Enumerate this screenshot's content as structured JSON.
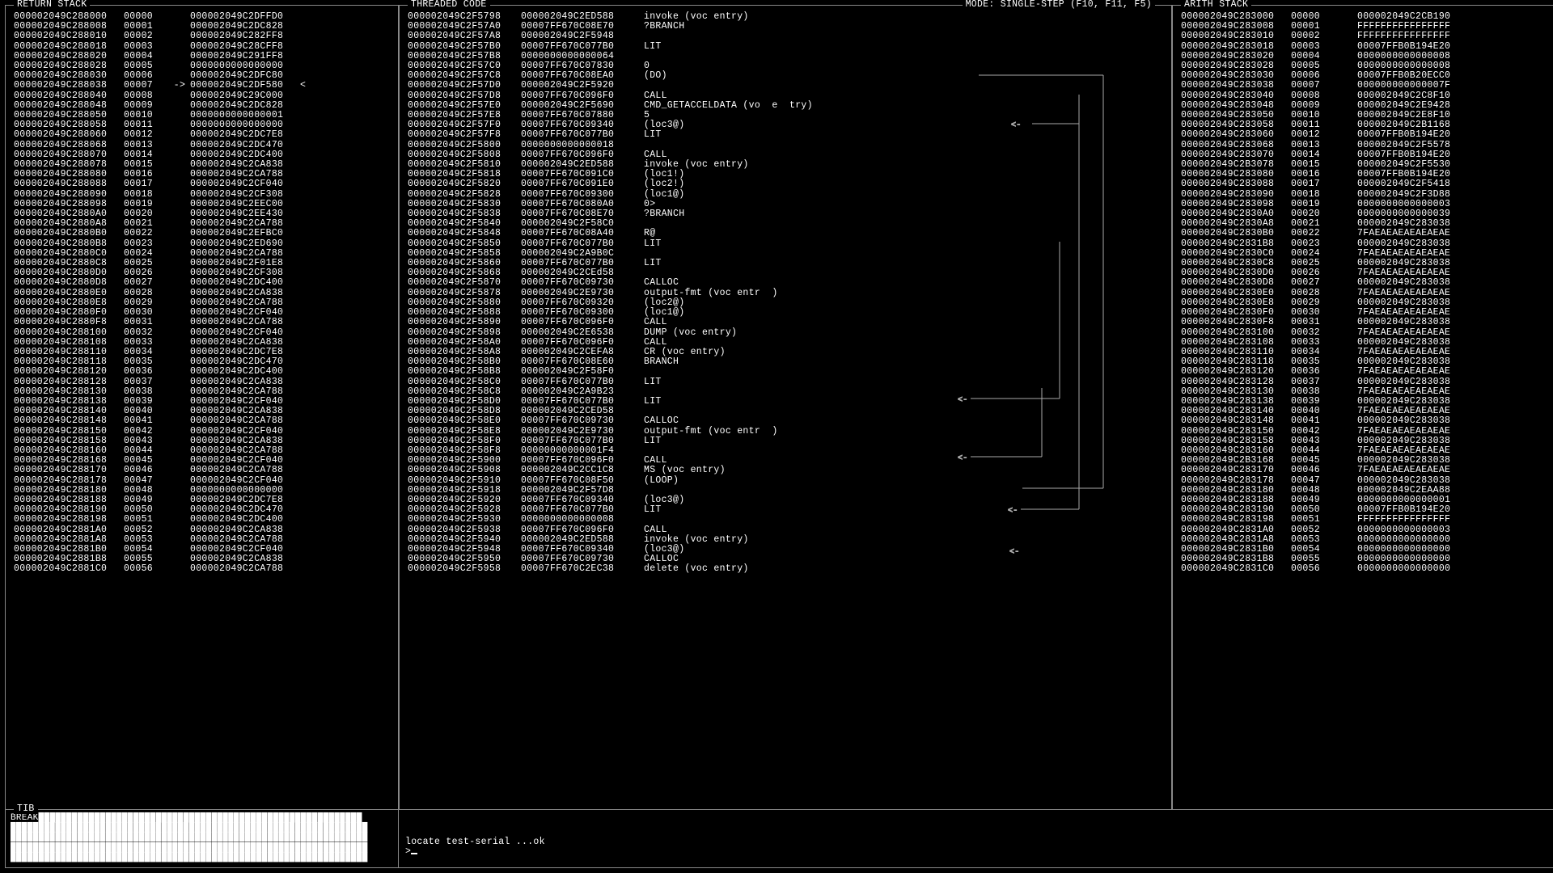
{
  "headers": {
    "return_stack": "RETURN STACK",
    "threaded_code": "THREADED CODE",
    "mode": "MODE: SINGLE-STEP (F10, F11, F5)",
    "arith_stack": "ARITH STACK",
    "tib": "TIB"
  },
  "return_stack": [
    {
      "addr": "000002049C288000",
      "idx": "00000",
      "hex": "000002049C2DFFD0"
    },
    {
      "addr": "000002049C288008",
      "idx": "00001",
      "hex": "000002049C2DC828"
    },
    {
      "addr": "000002049C288010",
      "idx": "00002",
      "hex": "000002049C282FF8"
    },
    {
      "addr": "000002049C288018",
      "idx": "00003",
      "hex": "000002049C28CFF8"
    },
    {
      "addr": "000002049C288020",
      "idx": "00004",
      "hex": "000002049C291FF8"
    },
    {
      "addr": "000002049C288028",
      "idx": "00005",
      "hex": "0000000000000000"
    },
    {
      "addr": "000002049C288030",
      "idx": "00006",
      "hex": "000002049C2DFC80"
    },
    {
      "addr": "000002049C288038",
      "idx": "00007",
      "hex": "000002049C2DF580",
      "arrow": "->",
      "end": "<"
    },
    {
      "addr": "000002049C288040",
      "idx": "00008",
      "hex": "000002049C29C000"
    },
    {
      "addr": "000002049C288048",
      "idx": "00009",
      "hex": "000002049C2DC828"
    },
    {
      "addr": "000002049C288050",
      "idx": "00010",
      "hex": "0000000000000001"
    },
    {
      "addr": "000002049C288058",
      "idx": "00011",
      "hex": "0000000000000000"
    },
    {
      "addr": "000002049C288060",
      "idx": "00012",
      "hex": "000002049C2DC7E8"
    },
    {
      "addr": "000002049C288068",
      "idx": "00013",
      "hex": "000002049C2DC470"
    },
    {
      "addr": "000002049C288070",
      "idx": "00014",
      "hex": "000002049C2DC400"
    },
    {
      "addr": "000002049C288078",
      "idx": "00015",
      "hex": "000002049C2CA838"
    },
    {
      "addr": "000002049C288080",
      "idx": "00016",
      "hex": "000002049C2CA788"
    },
    {
      "addr": "000002049C288088",
      "idx": "00017",
      "hex": "000002049C2CF040"
    },
    {
      "addr": "000002049C288090",
      "idx": "00018",
      "hex": "000002049C2CF308"
    },
    {
      "addr": "000002049C288098",
      "idx": "00019",
      "hex": "000002049C2EEC00"
    },
    {
      "addr": "000002049C2880A0",
      "idx": "00020",
      "hex": "000002049C2EE430"
    },
    {
      "addr": "000002049C2880A8",
      "idx": "00021",
      "hex": "000002049C2CA788"
    },
    {
      "addr": "000002049C2880B0",
      "idx": "00022",
      "hex": "000002049C2EFBC0"
    },
    {
      "addr": "000002049C2880B8",
      "idx": "00023",
      "hex": "000002049C2ED690"
    },
    {
      "addr": "000002049C2880C0",
      "idx": "00024",
      "hex": "000002049C2CA788"
    },
    {
      "addr": "000002049C2880C8",
      "idx": "00025",
      "hex": "000002049C2F01E8"
    },
    {
      "addr": "000002049C2880D0",
      "idx": "00026",
      "hex": "000002049C2CF308"
    },
    {
      "addr": "000002049C2880D8",
      "idx": "00027",
      "hex": "000002049C2DC400"
    },
    {
      "addr": "000002049C2880E0",
      "idx": "00028",
      "hex": "000002049C2CA838"
    },
    {
      "addr": "000002049C2880E8",
      "idx": "00029",
      "hex": "000002049C2CA788"
    },
    {
      "addr": "000002049C2880F0",
      "idx": "00030",
      "hex": "000002049C2CF040"
    },
    {
      "addr": "000002049C2880F8",
      "idx": "00031",
      "hex": "000002049C2CA788"
    },
    {
      "addr": "000002049C288100",
      "idx": "00032",
      "hex": "000002049C2CF040"
    },
    {
      "addr": "000002049C288108",
      "idx": "00033",
      "hex": "000002049C2CA838"
    },
    {
      "addr": "000002049C288110",
      "idx": "00034",
      "hex": "000002049C2DC7E8"
    },
    {
      "addr": "000002049C288118",
      "idx": "00035",
      "hex": "000002049C2DC470"
    },
    {
      "addr": "000002049C288120",
      "idx": "00036",
      "hex": "000002049C2DC400"
    },
    {
      "addr": "000002049C288128",
      "idx": "00037",
      "hex": "000002049C2CA838"
    },
    {
      "addr": "000002049C288130",
      "idx": "00038",
      "hex": "000002049C2CA788"
    },
    {
      "addr": "000002049C288138",
      "idx": "00039",
      "hex": "000002049C2CF040"
    },
    {
      "addr": "000002049C288140",
      "idx": "00040",
      "hex": "000002049C2CA838"
    },
    {
      "addr": "000002049C288148",
      "idx": "00041",
      "hex": "000002049C2CA788"
    },
    {
      "addr": "000002049C288150",
      "idx": "00042",
      "hex": "000002049C2CF040"
    },
    {
      "addr": "000002049C288158",
      "idx": "00043",
      "hex": "000002049C2CA838"
    },
    {
      "addr": "000002049C288160",
      "idx": "00044",
      "hex": "000002049C2CA788"
    },
    {
      "addr": "000002049C288168",
      "idx": "00045",
      "hex": "000002049C2CF040"
    },
    {
      "addr": "000002049C288170",
      "idx": "00046",
      "hex": "000002049C2CA788"
    },
    {
      "addr": "000002049C288178",
      "idx": "00047",
      "hex": "000002049C2CF040"
    },
    {
      "addr": "000002049C288180",
      "idx": "00048",
      "hex": "0000000000000000"
    },
    {
      "addr": "000002049C288188",
      "idx": "00049",
      "hex": "000002049C2DC7E8"
    },
    {
      "addr": "000002049C288190",
      "idx": "00050",
      "hex": "000002049C2DC470"
    },
    {
      "addr": "000002049C288198",
      "idx": "00051",
      "hex": "000002049C2DC400"
    },
    {
      "addr": "000002049C2881A0",
      "idx": "00052",
      "hex": "000002049C2CA838"
    },
    {
      "addr": "000002049C2881A8",
      "idx": "00053",
      "hex": "000002049C2CA788"
    },
    {
      "addr": "000002049C2881B0",
      "idx": "00054",
      "hex": "000002049C2CF040"
    },
    {
      "addr": "000002049C2881B8",
      "idx": "00055",
      "hex": "000002049C2CA838"
    },
    {
      "addr": "000002049C2881C0",
      "idx": "00056",
      "hex": "000002049C2CA788"
    }
  ],
  "threaded_code": [
    {
      "addr": "000002049C2F5798",
      "hex": "000002049C2ED588",
      "op": "invoke (voc entry)"
    },
    {
      "addr": "000002049C2F57A0",
      "hex": "00007FF670C08E70",
      "op": "?BRANCH"
    },
    {
      "addr": "000002049C2F57A8",
      "hex": "000002049C2F5948",
      "op": ""
    },
    {
      "addr": "000002049C2F57B0",
      "hex": "00007FF670C077B0",
      "op": "LIT"
    },
    {
      "addr": "000002049C2F57B8",
      "hex": "0000000000000064",
      "op": ""
    },
    {
      "addr": "000002049C2F57C0",
      "hex": "00007FF670C07830",
      "op": "0"
    },
    {
      "addr": "000002049C2F57C8",
      "hex": "00007FF670C08EA0",
      "op": "(DO)"
    },
    {
      "addr": "000002049C2F57D0",
      "hex": "000002049C2F5920",
      "op": ""
    },
    {
      "addr": "000002049C2F57D8",
      "hex": "00007FF670C096F0",
      "op": "CALL"
    },
    {
      "addr": "000002049C2F57E0",
      "hex": "000002049C2F5690",
      "op": "CMD_GETACCELDATA (vo  e  try)"
    },
    {
      "addr": "000002049C2F57E8",
      "hex": "00007FF670C07880",
      "op": "5"
    },
    {
      "addr": "000002049C2F57F0",
      "hex": "00007FF670C09340",
      "op": "(loc3@)"
    },
    {
      "addr": "000002049C2F57F8",
      "hex": "00007FF670C077B0",
      "op": "LIT"
    },
    {
      "addr": "000002049C2F5800",
      "hex": "0000000000000018",
      "op": ""
    },
    {
      "addr": "000002049C2F5808",
      "hex": "00007FF670C096F0",
      "op": "CALL"
    },
    {
      "addr": "000002049C2F5810",
      "hex": "000002049C2ED588",
      "op": "invoke (voc entry)"
    },
    {
      "addr": "000002049C2F5818",
      "hex": "00007FF670C091C0",
      "op": "(loc1!)"
    },
    {
      "addr": "000002049C2F5820",
      "hex": "00007FF670C091E0",
      "op": "(loc2!)"
    },
    {
      "addr": "000002049C2F5828",
      "hex": "00007FF670C09300",
      "op": "(loc1@)"
    },
    {
      "addr": "000002049C2F5830",
      "hex": "00007FF670C080A0",
      "op": "0>"
    },
    {
      "addr": "000002049C2F5838",
      "hex": "00007FF670C08E70",
      "op": "?BRANCH"
    },
    {
      "addr": "000002049C2F5840",
      "hex": "000002049C2F58C0",
      "op": ""
    },
    {
      "addr": "000002049C2F5848",
      "hex": "00007FF670C08A40",
      "op": "R@"
    },
    {
      "addr": "000002049C2F5850",
      "hex": "00007FF670C077B0",
      "op": "LIT"
    },
    {
      "addr": "000002049C2F5858",
      "hex": "000002049C2A9B0C",
      "op": ""
    },
    {
      "addr": "000002049C2F5860",
      "hex": "00007FF670C077B0",
      "op": "LIT"
    },
    {
      "addr": "000002049C2F5868",
      "hex": "000002049C2CEd58",
      "op": ""
    },
    {
      "addr": "000002049C2F5870",
      "hex": "00007FF670C09730",
      "op": "CALLOC"
    },
    {
      "addr": "000002049C2F5878",
      "hex": "000002049C2E9730",
      "op": "output-fmt (voc entr  )"
    },
    {
      "addr": "000002049C2F5880",
      "hex": "00007FF670C09320",
      "op": "(loc2@)"
    },
    {
      "addr": "000002049C2F5888",
      "hex": "00007FF670C09300",
      "op": "(loc1@)"
    },
    {
      "addr": "000002049C2F5890",
      "hex": "00007FF670C096F0",
      "op": "CALL"
    },
    {
      "addr": "000002049C2F5898",
      "hex": "000002049C2E6538",
      "op": "DUMP (voc entry)"
    },
    {
      "addr": "000002049C2F58A0",
      "hex": "00007FF670C096F0",
      "op": "CALL"
    },
    {
      "addr": "000002049C2F58A8",
      "hex": "000002049C2CEFA8",
      "op": "CR (voc entry)"
    },
    {
      "addr": "000002049C2F58B0",
      "hex": "00007FF670C08E60",
      "op": "BRANCH"
    },
    {
      "addr": "000002049C2F58B8",
      "hex": "000002049C2F58F0",
      "op": ""
    },
    {
      "addr": "000002049C2F58C0",
      "hex": "00007FF670C077B0",
      "op": "LIT"
    },
    {
      "addr": "000002049C2F58C8",
      "hex": "000002049C2A9B23",
      "op": ""
    },
    {
      "addr": "000002049C2F58D0",
      "hex": "00007FF670C077B0",
      "op": "LIT"
    },
    {
      "addr": "000002049C2F58D8",
      "hex": "000002049C2CED58",
      "op": ""
    },
    {
      "addr": "000002049C2F58E0",
      "hex": "00007FF670C09730",
      "op": "CALLOC"
    },
    {
      "addr": "000002049C2F58E8",
      "hex": "000002049C2E9730",
      "op": "output-fmt (voc entr  )"
    },
    {
      "addr": "000002049C2F58F0",
      "hex": "00007FF670C077B0",
      "op": "LIT"
    },
    {
      "addr": "000002049C2F58F8",
      "hex": "00000000000001F4",
      "op": ""
    },
    {
      "addr": "000002049C2F5900",
      "hex": "00007FF670C096F0",
      "op": "CALL"
    },
    {
      "addr": "000002049C2F5908",
      "hex": "000002049C2CC1C8",
      "op": "MS (voc entry)"
    },
    {
      "addr": "000002049C2F5910",
      "hex": "00007FF670C08F50",
      "op": "(LOOP)"
    },
    {
      "addr": "000002049C2F5918",
      "hex": "000002049C2F57D8",
      "op": ""
    },
    {
      "addr": "000002049C2F5920",
      "hex": "00007FF670C09340",
      "op": "(loc3@)"
    },
    {
      "addr": "000002049C2F5928",
      "hex": "00007FF670C077B0",
      "op": "LIT"
    },
    {
      "addr": "000002049C2F5930",
      "hex": "0000000000000008",
      "op": ""
    },
    {
      "addr": "000002049C2F5938",
      "hex": "00007FF670C096F0",
      "op": "CALL"
    },
    {
      "addr": "000002049C2F5940",
      "hex": "000002049C2ED588",
      "op": "invoke (voc entry)"
    },
    {
      "addr": "000002049C2F5948",
      "hex": "00007FF670C09340",
      "op": "(loc3@)"
    },
    {
      "addr": "000002049C2F5950",
      "hex": "00007FF670C09730",
      "op": "CALLOC"
    },
    {
      "addr": "000002049C2F5958",
      "hex": "00007FF670C2EC38",
      "op": "delete (voc entry)"
    }
  ],
  "arith_stack": [
    {
      "addr": "000002049C283000",
      "idx": "00000",
      "hex": "000002049C2CB190"
    },
    {
      "addr": "000002049C283008",
      "idx": "00001",
      "hex": "FFFFFFFFFFFFFFFF"
    },
    {
      "addr": "000002049C283010",
      "idx": "00002",
      "hex": "FFFFFFFFFFFFFFFF"
    },
    {
      "addr": "000002049C283018",
      "idx": "00003",
      "hex": "00007FFB0B194E20"
    },
    {
      "addr": "000002049C283020",
      "idx": "00004",
      "hex": "0000000000000008"
    },
    {
      "addr": "000002049C283028",
      "idx": "00005",
      "hex": "0000000000000008"
    },
    {
      "addr": "000002049C283030",
      "idx": "00006",
      "hex": "00007FFB0B20ECC0"
    },
    {
      "addr": "000002049C283038",
      "idx": "00007",
      "hex": "000000000000007F"
    },
    {
      "addr": "000002049C283040",
      "idx": "00008",
      "hex": "000002049C2C8F10"
    },
    {
      "addr": "000002049C283048",
      "idx": "00009",
      "hex": "000002049C2E9428"
    },
    {
      "addr": "000002049C283050",
      "idx": "00010",
      "hex": "000002049C2E8F10"
    },
    {
      "addr": "000002049C283058",
      "idx": "00011",
      "hex": "000002049C2B1168"
    },
    {
      "addr": "000002049C283060",
      "idx": "00012",
      "hex": "00007FFB0B194E20"
    },
    {
      "addr": "000002049C283068",
      "idx": "00013",
      "hex": "000002049C2F5578"
    },
    {
      "addr": "000002049C283070",
      "idx": "00014",
      "hex": "00007FFB0B194E20"
    },
    {
      "addr": "000002049C2B3078",
      "idx": "00015",
      "hex": "000002049C2F5530"
    },
    {
      "addr": "000002049C283080",
      "idx": "00016",
      "hex": "00007FFB0B194E20"
    },
    {
      "addr": "000002049C283088",
      "idx": "00017",
      "hex": "000002049C2F5418"
    },
    {
      "addr": "000002049C283090",
      "idx": "00018",
      "hex": "000002049C2F3D88"
    },
    {
      "addr": "000002049C283098",
      "idx": "00019",
      "hex": "0000000000000003"
    },
    {
      "addr": "000002049C2830A0",
      "idx": "00020",
      "hex": "0000000000000039"
    },
    {
      "addr": "000002049C2830A8",
      "idx": "00021",
      "hex": "000002049C283038"
    },
    {
      "addr": "000002049C2830B0",
      "idx": "00022",
      "hex": "7FAEAEAEAEAEAEAE"
    },
    {
      "addr": "000002049C2831B8",
      "idx": "00023",
      "hex": "000002049C283038"
    },
    {
      "addr": "000002049C2830C0",
      "idx": "00024",
      "hex": "7FAEAEAEAEAEAEAE"
    },
    {
      "addr": "000002049C2830C8",
      "idx": "00025",
      "hex": "000002049C283038"
    },
    {
      "addr": "000002049C2830D0",
      "idx": "00026",
      "hex": "7FAEAEAEAEAEAEAE"
    },
    {
      "addr": "000002049C2830D8",
      "idx": "00027",
      "hex": "000002049C283038"
    },
    {
      "addr": "000002049C2830E0",
      "idx": "00028",
      "hex": "7FAEAEAEAEAEAEAE"
    },
    {
      "addr": "000002049C2830E8",
      "idx": "00029",
      "hex": "000002049C283038"
    },
    {
      "addr": "000002049C2830F0",
      "idx": "00030",
      "hex": "7FAEAEAEAEAEAEAE"
    },
    {
      "addr": "000002049C2830F8",
      "idx": "00031",
      "hex": "000002049C283038"
    },
    {
      "addr": "000002049C283100",
      "idx": "00032",
      "hex": "7FAEAEAEAEAEAEAE"
    },
    {
      "addr": "000002049C283108",
      "idx": "00033",
      "hex": "000002049C283038"
    },
    {
      "addr": "000002049C283110",
      "idx": "00034",
      "hex": "7FAEAEAEAEAEAEAE"
    },
    {
      "addr": "000002049C283118",
      "idx": "00035",
      "hex": "000002049C283038"
    },
    {
      "addr": "000002049C283120",
      "idx": "00036",
      "hex": "7FAEAEAEAEAEAEAE"
    },
    {
      "addr": "000002049C283128",
      "idx": "00037",
      "hex": "000002049C283038"
    },
    {
      "addr": "000002049C283130",
      "idx": "00038",
      "hex": "7FAEAEAEAEAEAEAE"
    },
    {
      "addr": "000002049C283138",
      "idx": "00039",
      "hex": "000002049C283038"
    },
    {
      "addr": "000002049C283140",
      "idx": "00040",
      "hex": "7FAEAEAEAEAEAEAE"
    },
    {
      "addr": "000002049C283148",
      "idx": "00041",
      "hex": "000002049C283038"
    },
    {
      "addr": "000002049C283150",
      "idx": "00042",
      "hex": "7FAEAEAEAEAEAEAE"
    },
    {
      "addr": "000002049C283158",
      "idx": "00043",
      "hex": "000002049C283038"
    },
    {
      "addr": "000002049C283160",
      "idx": "00044",
      "hex": "7FAEAEAEAEAEAEAE"
    },
    {
      "addr": "000002049C2B3168",
      "idx": "00045",
      "hex": "000002049C283038"
    },
    {
      "addr": "000002049C283170",
      "idx": "00046",
      "hex": "7FAEAEAEAEAEAEAE"
    },
    {
      "addr": "000002049C283178",
      "idx": "00047",
      "hex": "000002049C283038"
    },
    {
      "addr": "000002049C283180",
      "idx": "00048",
      "hex": "000002049C2EAA88"
    },
    {
      "addr": "000002049C283188",
      "idx": "00049",
      "hex": "0000000000000001"
    },
    {
      "addr": "000002049C283190",
      "idx": "00050",
      "hex": "00007FFB0B194E20"
    },
    {
      "addr": "000002049C283198",
      "idx": "00051",
      "hex": "FFFFFFFFFFFFFFFF"
    },
    {
      "addr": "000002049C2831A0",
      "idx": "00052",
      "hex": "0000000000000003"
    },
    {
      "addr": "000002049C2831A8",
      "idx": "00053",
      "hex": "0000000000000000"
    },
    {
      "addr": "000002049C2831B0",
      "idx": "00054",
      "hex": "0000000000000000"
    },
    {
      "addr": "000002049C2831B8",
      "idx": "00055",
      "hex": "0000000000000000"
    },
    {
      "addr": "000002049C2831C0",
      "idx": "00056",
      "hex": "0000000000000000"
    }
  ],
  "tib_label": "BREAK",
  "console_output": "locate test-serial ...ok",
  "console_prompt": ">"
}
